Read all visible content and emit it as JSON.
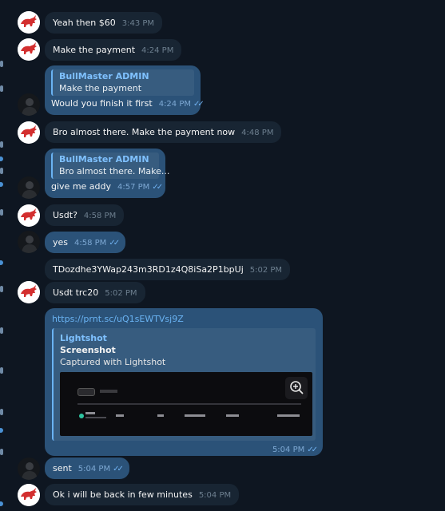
{
  "participants": {
    "admin_name": "BullMaster ADMIN"
  },
  "messages": [
    {
      "side": "in",
      "text": "Yeah then $60",
      "time": "3:43 PM"
    },
    {
      "side": "in",
      "text": "Make the payment",
      "time": "4:24 PM"
    },
    {
      "side": "out",
      "reply_name": "BullMaster ADMIN",
      "reply_text": "Make the payment",
      "text": "Would you finish it first",
      "time": "4:24 PM"
    },
    {
      "side": "in",
      "text": "Bro almost there. Make the payment now",
      "time": "4:48 PM"
    },
    {
      "side": "out",
      "reply_name": "BullMaster ADMIN",
      "reply_text": "Bro almost there. Make...",
      "text": "give me addy",
      "time": "4:57 PM"
    },
    {
      "side": "in",
      "text": "Usdt?",
      "time": "4:58 PM"
    },
    {
      "side": "out",
      "text": "yes",
      "time": "4:58 PM"
    },
    {
      "side": "in",
      "text": "TDozdhe3YWap243m3RD1z4Q8iSa2P1bpUj",
      "time": "5:02 PM"
    },
    {
      "side": "in",
      "text": "Usdt trc20",
      "time": "5:02 PM"
    },
    {
      "side": "out",
      "link": "https://prnt.sc/uQ1sEWTVsj9Z",
      "preview_site": "Lightshot",
      "preview_title": "Screenshot",
      "preview_desc": "Captured with Lightshot",
      "time": "5:04 PM"
    },
    {
      "side": "out",
      "text": "sent",
      "time": "5:04 PM"
    },
    {
      "side": "in",
      "text": "Ok i will be back in few minutes",
      "time": "5:04 PM"
    }
  ],
  "icons": {
    "read_receipt": "double-check-icon",
    "zoom": "zoom-in-icon",
    "avatar_admin": "red-bull-logo",
    "avatar_user": "dark-person-avatar"
  },
  "colors": {
    "background": "#0e1621",
    "incoming_bubble": "#182533",
    "outgoing_bubble": "#2b5278",
    "link": "#6ab3f3",
    "bull_red": "#d32f2f"
  }
}
